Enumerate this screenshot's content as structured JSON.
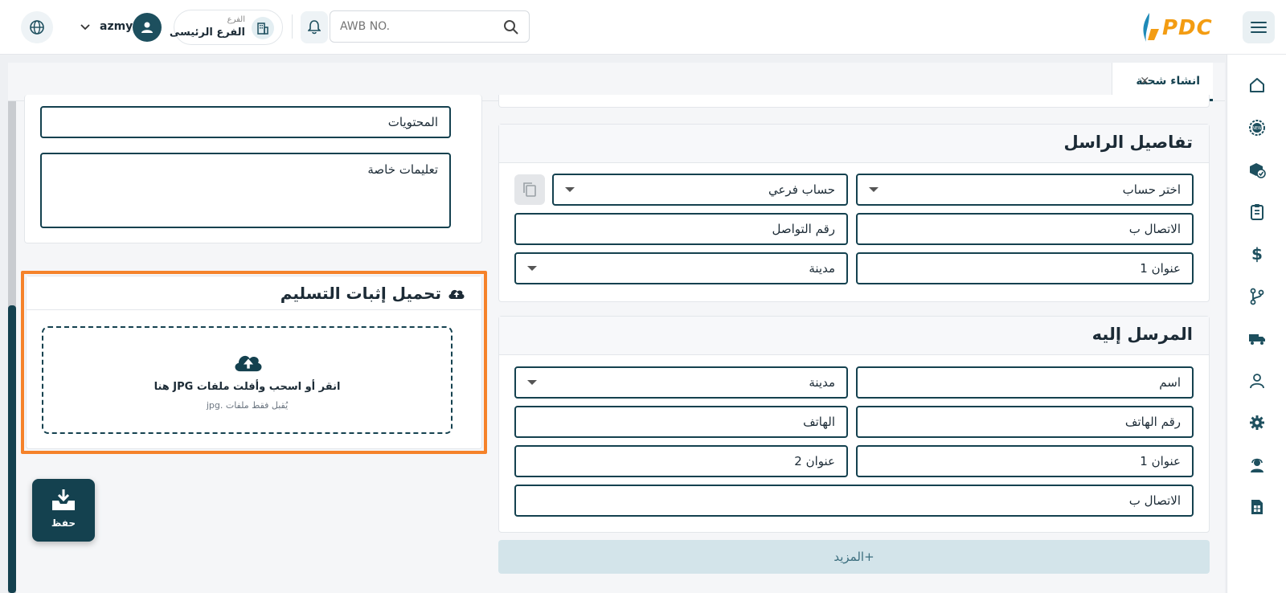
{
  "topbar": {
    "user_name": "azmy",
    "branch_label": "الفرع",
    "branch_value": "الفرع الرئيسى",
    "awb_placeholder": "AWB NO.",
    "logo_text": "PDC"
  },
  "tabs": [
    {
      "label": "انشاء شحنة",
      "close": "×"
    }
  ],
  "sender": {
    "title": "تفاصيل الراسل",
    "select_account": "اختر حساب",
    "sub_account": "حساب فرعي",
    "contact_person": "الاتصال ب",
    "contact_number": "رقم التواصل",
    "address1": "عنوان 1",
    "city": "مدينة"
  },
  "receiver": {
    "title": "المرسل إليه",
    "name": "اسم",
    "city": "مدينة",
    "phone_number": "رقم الهاتف",
    "phone": "الهاتف",
    "address1": "عنوان 1",
    "address2": "عنوان 2",
    "contact_person": "الاتصال ب"
  },
  "more_button": "+المزيد",
  "shipment": {
    "contents": "المحتويات",
    "special_instructions": "تعليمات خاصة"
  },
  "upload": {
    "title": "تحميل إثبات التسليم",
    "drop_text": "انقر أو اسحب وأفلت ملفات JPG هنا",
    "hint": "يُقبل فقط ملفات .jpg"
  },
  "save_button": "حفظ",
  "colors": {
    "primary": "#14414f",
    "accent_orange": "#f5822a",
    "logo_orange": "#f39c12",
    "logo_blue": "#1e8ab8",
    "more_bg": "#d3e4ea"
  },
  "sidebar_icons": [
    "home-icon",
    "new-badge-icon",
    "box-check-icon",
    "clipboard-icon",
    "dollar-icon",
    "branch-icon",
    "truck-icon",
    "user-icon",
    "gear-icon",
    "support-agent-icon",
    "sim-card-icon"
  ]
}
